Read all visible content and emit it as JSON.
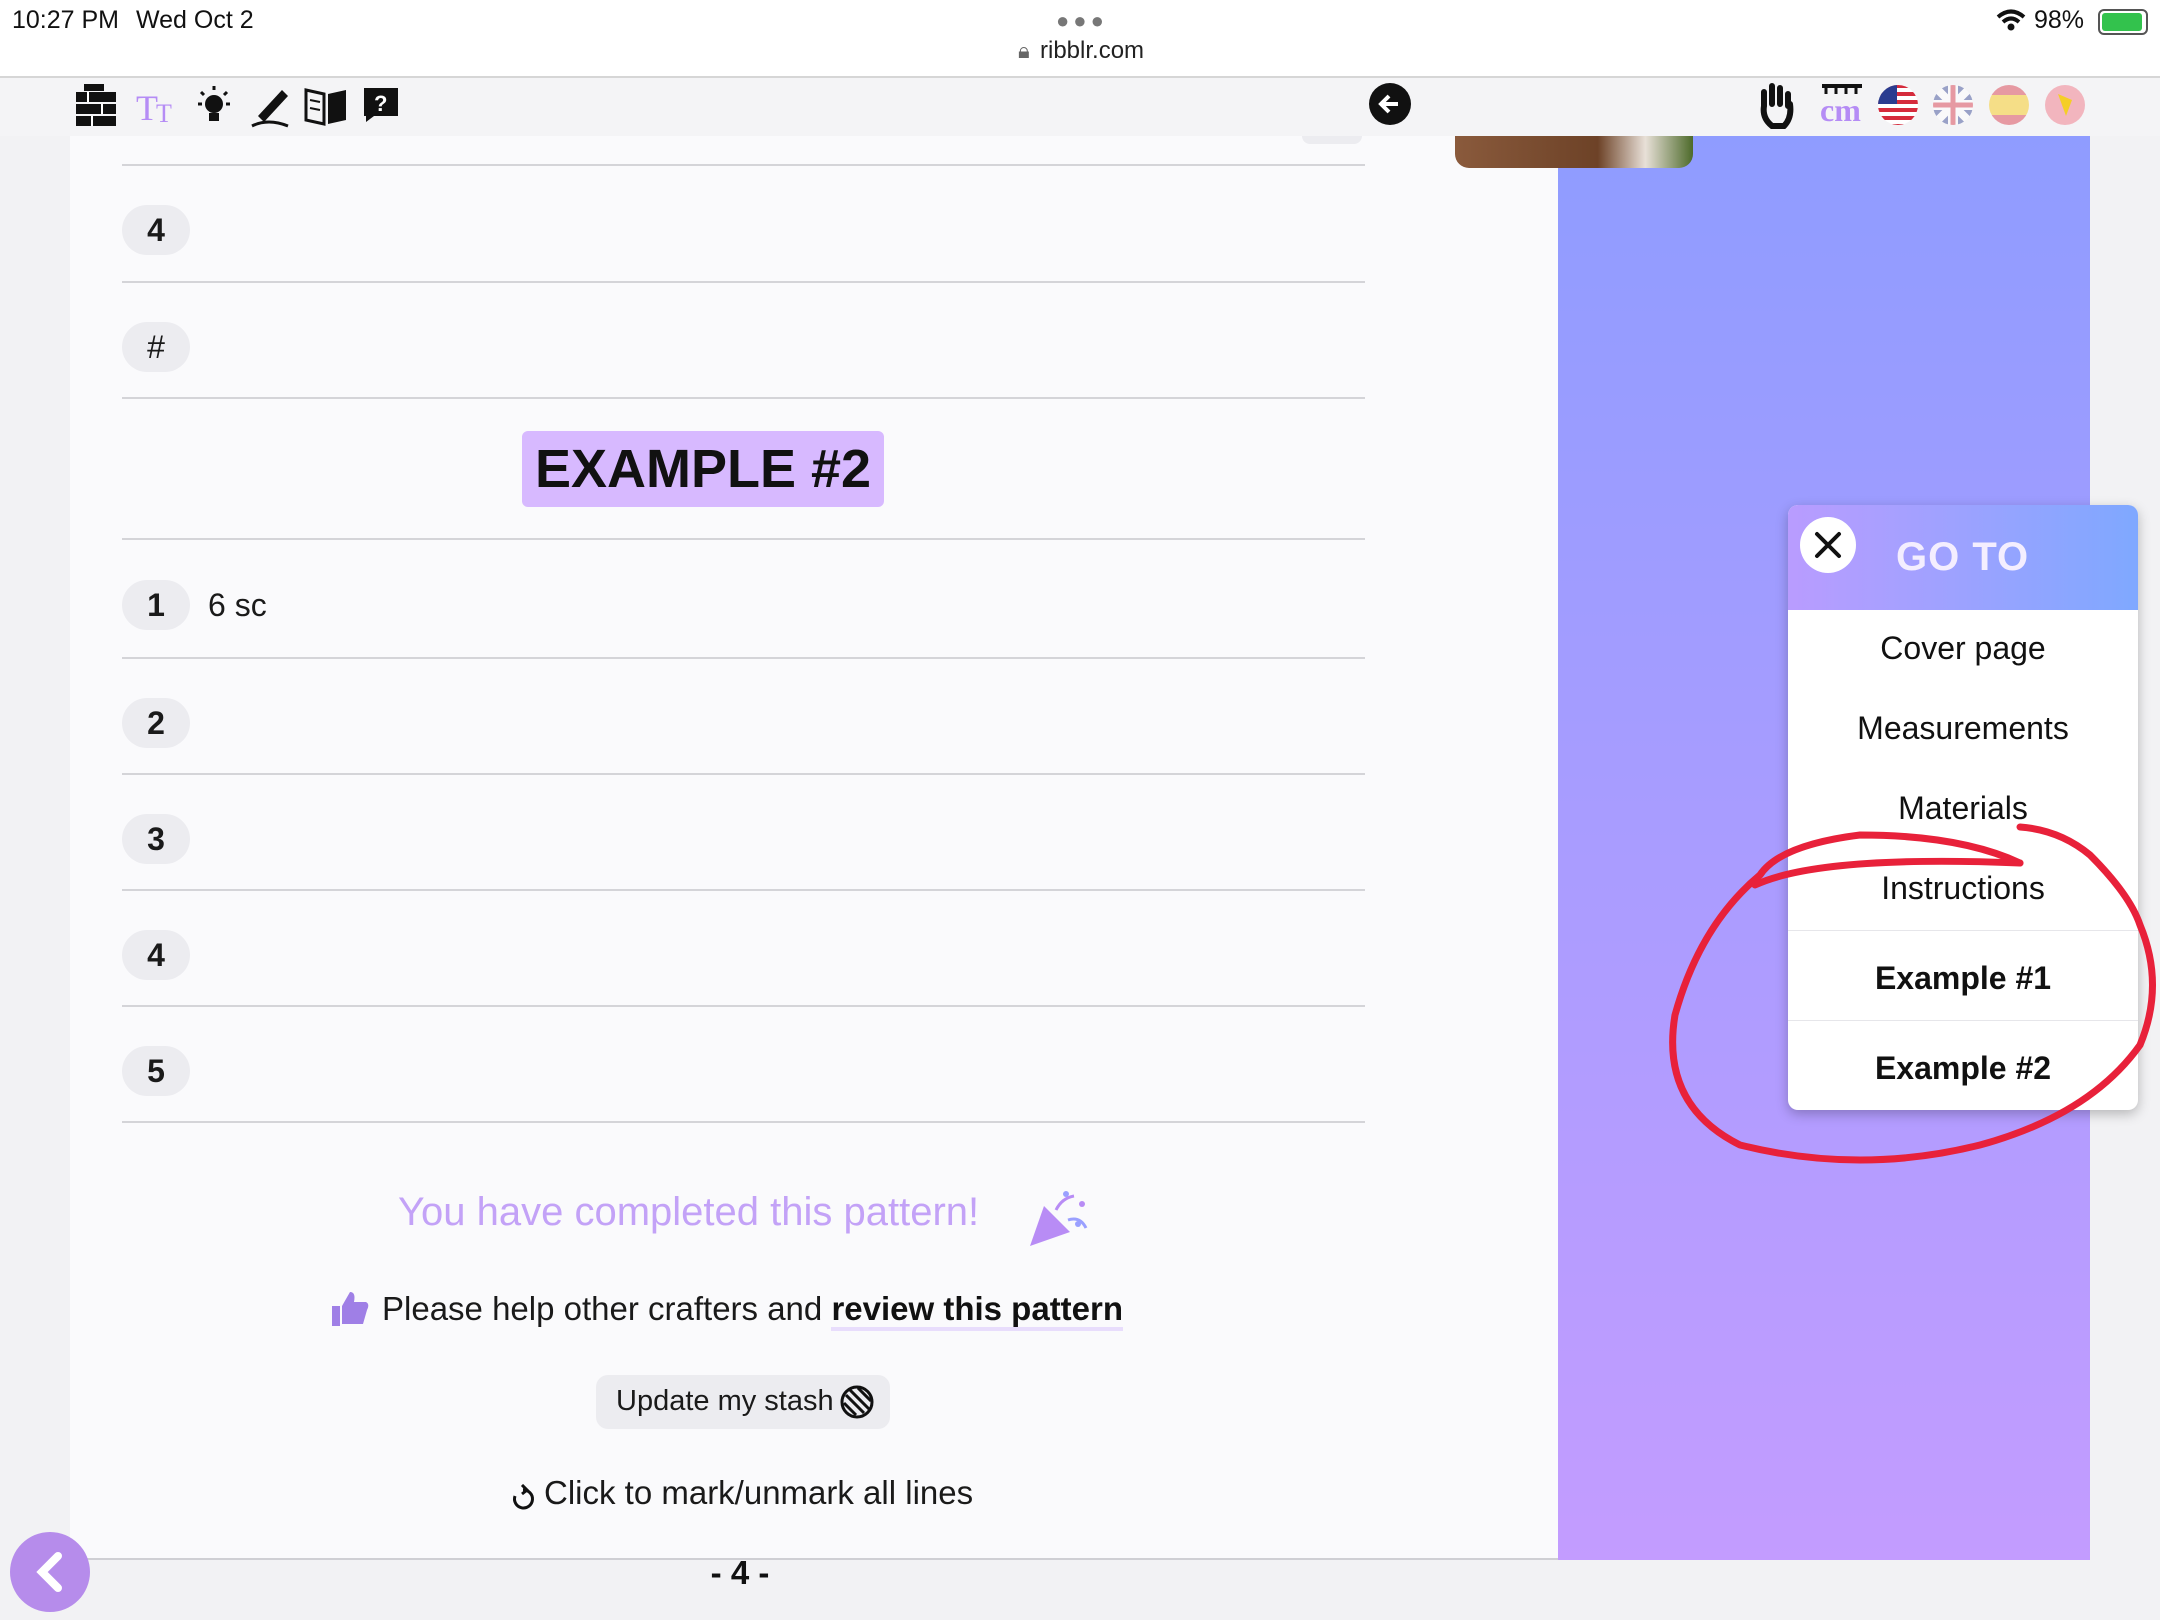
{
  "status_bar": {
    "time": "10:27 PM",
    "date": "Wed Oct 2",
    "url": "ribblr.com",
    "battery": "98%"
  },
  "toolbar": {
    "left_icons": [
      "yarn-stash-icon",
      "text-size-icon",
      "lightbulb-icon",
      "pen-icon",
      "book-icon",
      "help-icon"
    ],
    "back_icon": "back-arrow-icon",
    "right_icons": [
      "hand-icon",
      "cm-label",
      "us-flag-icon",
      "uk-flag-icon",
      "spain-flag-icon",
      "globe-icon"
    ],
    "cm_label": "cm"
  },
  "rows_top": [
    {
      "num": "4",
      "text": ""
    },
    {
      "num": "#",
      "text": ""
    }
  ],
  "section_title": "EXAMPLE #2",
  "rows": [
    {
      "num": "1",
      "text": "6 sc"
    },
    {
      "num": "2",
      "text": ""
    },
    {
      "num": "3",
      "text": ""
    },
    {
      "num": "4",
      "text": ""
    },
    {
      "num": "5",
      "text": ""
    }
  ],
  "completed_text": "You have completed this pattern!",
  "review_prefix": "Please help other crafters and",
  "review_link": "review this pattern",
  "update_stash_label": "Update my stash",
  "mark_all_label": "Click to mark/unmark all lines",
  "page_number": "- 4 -",
  "goto": {
    "title": "GO TO",
    "items": [
      "Cover page",
      "Measurements",
      "Materials",
      "Instructions",
      "Example #1",
      "Example #2"
    ]
  },
  "colors": {
    "accent": "#c9a4ff",
    "annotation": "#e8213a",
    "title_highlight": "#d7b9ff"
  }
}
